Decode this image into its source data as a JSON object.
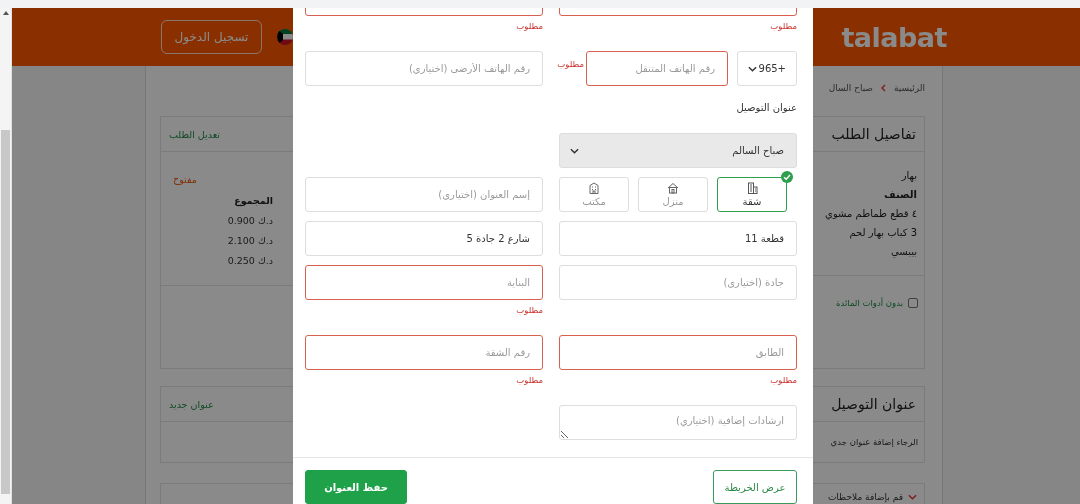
{
  "header": {
    "logo": "talabat",
    "login_button": "تسجيل الدخول"
  },
  "breadcrumb": [
    {
      "label": "الرئيسية"
    },
    {
      "label": "صباح السال"
    }
  ],
  "order_panel": {
    "title": "تفاصيل الطلب",
    "edit_link": "تعديل الطلب",
    "restaurant": "بهار",
    "status": "مفتوح",
    "item_header": "الصنف",
    "total_header": "المجموع",
    "items": [
      {
        "name": "٤ قطع طماطم مشوي",
        "total": "د.ك 0.900"
      },
      {
        "name": "3 كباب بهار لحم",
        "total": "د.ك 2.100"
      },
      {
        "name": "بيبسي",
        "total": "د.ك 0.250"
      }
    ],
    "cutlery": {
      "label": "بدون أدوات المائدة",
      "checked": false
    }
  },
  "address_panel": {
    "title": "عنوان التوصيل",
    "new_link": "عنوان جديد",
    "message": "الرجاء إضافة عنوان جدي"
  },
  "notes_panel": {
    "label": "قم بإضافة ملاحظات"
  },
  "modal": {
    "rows": [
      {
        "cells": [
          {
            "kind": "field",
            "error": "مطلوب"
          },
          {
            "kind": "field",
            "error": "مطلوب"
          }
        ]
      },
      {
        "cells": [
          {
            "kind": "phone",
            "code": "+965",
            "placeholder": "رقم الهاتف المتنقل",
            "error": "مطلوب"
          },
          {
            "kind": "field",
            "placeholder": "رقم الهاتف الأرضي (اختياري)"
          }
        ]
      },
      {
        "cells": [
          {
            "kind": "label",
            "text": "عنوان التوصيل"
          }
        ]
      },
      {
        "cells": [
          {
            "kind": "select",
            "value": "صباح السالم"
          }
        ]
      },
      {
        "cells": [
          {
            "kind": "types",
            "options": [
              {
                "label": "شقة",
                "selected": true
              },
              {
                "label": "منزل",
                "selected": false
              },
              {
                "label": "مكتب",
                "selected": false
              }
            ]
          },
          {
            "kind": "field",
            "placeholder": "إسم العنوان (اختياري)"
          }
        ]
      },
      {
        "cells": [
          {
            "kind": "field",
            "value": "قطعة 11"
          },
          {
            "kind": "field",
            "value": "شارع 2 جادة 5"
          }
        ]
      },
      {
        "cells": [
          {
            "kind": "field",
            "placeholder": "جادة (اختياري)"
          },
          {
            "kind": "field",
            "placeholder": "البناية",
            "error": "مطلوب"
          }
        ]
      },
      {
        "cells": [
          {
            "kind": "field",
            "placeholder": "الطابق",
            "error": "مطلوب"
          },
          {
            "kind": "field",
            "placeholder": "رقم الشقة",
            "error": "مطلوب"
          }
        ]
      },
      {
        "cells": [
          {
            "kind": "textarea",
            "placeholder": "ارشادات إضافية (اختياري)"
          }
        ]
      }
    ],
    "buttons": [
      {
        "kind": "outline",
        "label": "عرض الخريطة"
      },
      {
        "kind": "primary",
        "label": "حفظ العنوان"
      }
    ]
  }
}
